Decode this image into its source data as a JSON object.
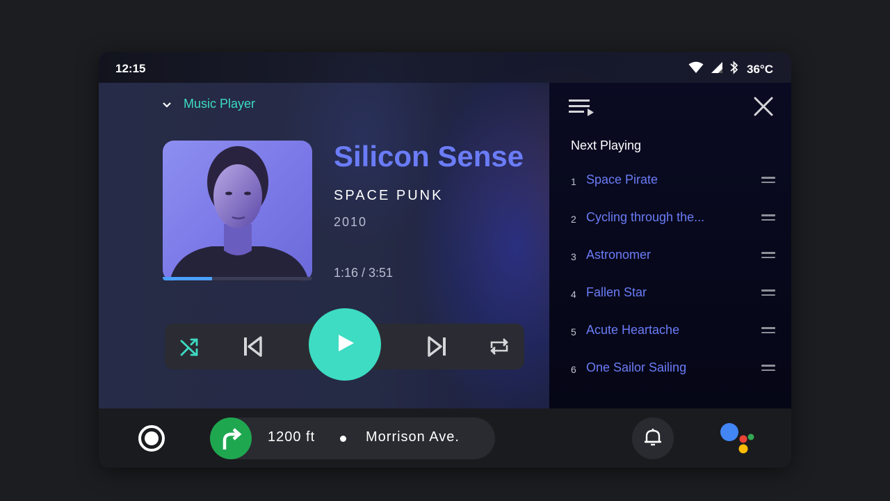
{
  "status_bar": {
    "time": "12:15",
    "temperature": "36°C",
    "icons": [
      "wifi-icon",
      "cell-signal-icon",
      "bluetooth-icon"
    ]
  },
  "player": {
    "header_label": "Music Player",
    "track": {
      "title": "Silicon Sense",
      "artist": "SPACE PUNK",
      "year": "2010",
      "time_display": "1:16 / 3:51",
      "progress_fraction": 0.33
    },
    "controls": [
      "shuffle-icon",
      "previous-icon",
      "play-icon",
      "next-icon",
      "repeat-icon"
    ]
  },
  "queue": {
    "heading": "Next Playing",
    "items": [
      {
        "num": "1",
        "title": "Space Pirate"
      },
      {
        "num": "2",
        "title": "Cycling through the..."
      },
      {
        "num": "3",
        "title": "Astronomer"
      },
      {
        "num": "4",
        "title": "Fallen Star"
      },
      {
        "num": "5",
        "title": "Acute Heartache"
      },
      {
        "num": "6",
        "title": "One Sailor Sailing"
      }
    ]
  },
  "navigation": {
    "distance": "1200 ft",
    "street": "Morrison Ave."
  },
  "colors": {
    "accent_teal": "#3ddcc3",
    "track_blue": "#6b7cf7",
    "nav_green": "#1fa750"
  }
}
